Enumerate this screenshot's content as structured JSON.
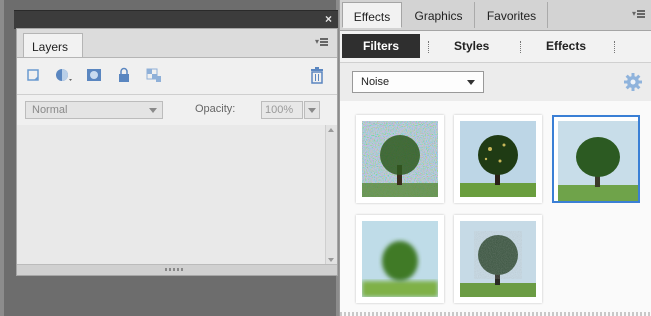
{
  "layers_panel": {
    "close_glyph": "×",
    "tab_label": "Layers",
    "menu_icon": "panel-menu-icon",
    "tools": [
      "new-layer-icon",
      "adjustment-layer-icon",
      "layer-mask-icon",
      "lock-icon",
      "lock-transparency-icon"
    ],
    "delete_icon": "trash-icon",
    "blend_mode": "Normal",
    "opacity_label": "Opacity:",
    "opacity_value": "100%"
  },
  "effects_panel": {
    "tabs": [
      "Effects",
      "Graphics",
      "Favorites"
    ],
    "active_tab": "Effects",
    "subtabs": [
      "Filters",
      "Styles",
      "Effects"
    ],
    "active_subtab": "Filters",
    "filter_category": "Noise",
    "settings_icon": "gear-icon",
    "accent_color": "#3a7fd5",
    "thumbnails": [
      {
        "name": "noise-thumbnail-1",
        "selected": false
      },
      {
        "name": "noise-thumbnail-2",
        "selected": false
      },
      {
        "name": "noise-thumbnail-3",
        "selected": true
      },
      {
        "name": "noise-thumbnail-4",
        "selected": false
      },
      {
        "name": "noise-thumbnail-5",
        "selected": false
      }
    ]
  }
}
